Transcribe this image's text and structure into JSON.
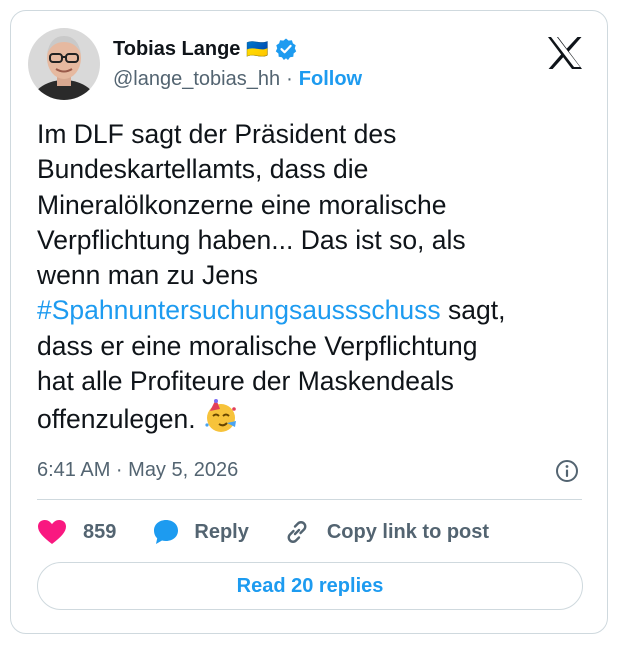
{
  "author": {
    "name": "Tobias Lange",
    "flag": "🇺🇦",
    "handle": "@lange_tobias_hh",
    "separator": "·",
    "follow_label": "Follow"
  },
  "tweet": {
    "lines": [
      "Im DLF sagt der Präsident des",
      "Bundeskartellamts, dass die",
      "Mineralölkonzerne eine moralische",
      "Verpflichtung haben... Das ist so, als",
      "wenn man zu Jens"
    ],
    "hashtag": "#Spahnuntersuchungsaussschuss",
    "after_hashtag": " sagt,",
    "lines2": [
      "dass er eine moralische Verpflichtung",
      "hat alle Profiteure der Maskendeals"
    ],
    "last_line": "offenzulegen. "
  },
  "meta": {
    "timestamp": "6:41 AM · May 5, 2026"
  },
  "actions": {
    "likes": "859",
    "reply_label": "Reply",
    "copy_label": "Copy link to post"
  },
  "replies_button": "Read 20 replies",
  "colors": {
    "accent": "#1d9bf0",
    "like": "#f91880",
    "muted": "#536471",
    "border": "#cfd9de"
  }
}
